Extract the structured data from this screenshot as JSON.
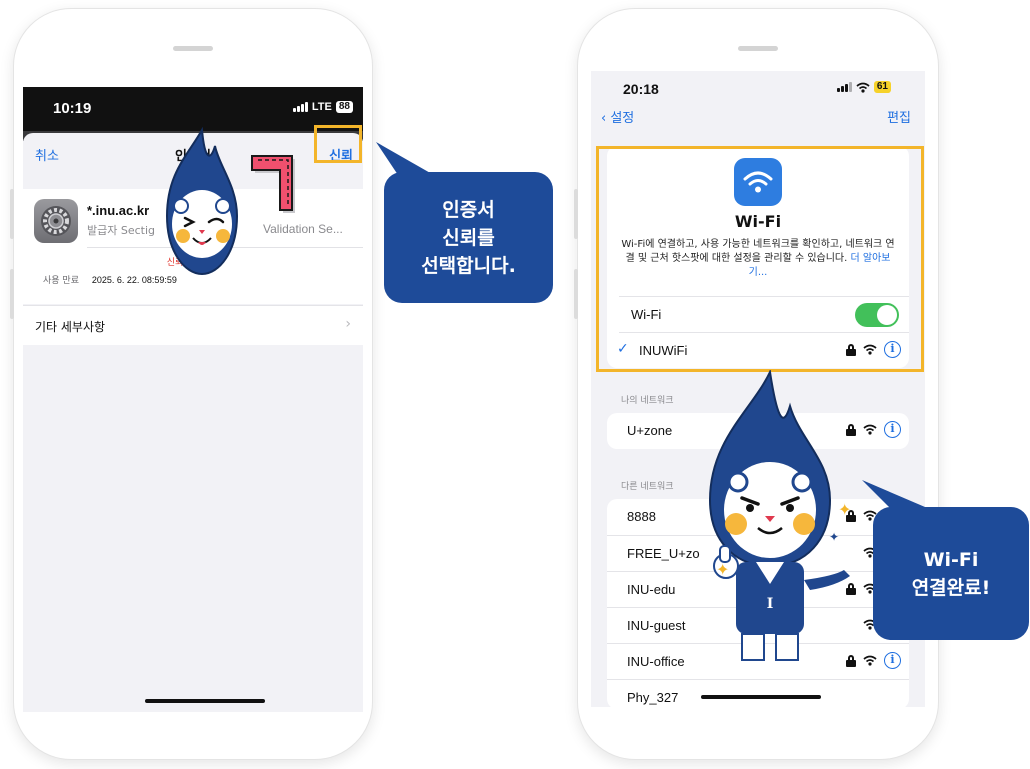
{
  "left_phone": {
    "status": {
      "time": "10:19",
      "network": "LTE",
      "battery": "88"
    },
    "nav": {
      "cancel": "취소",
      "title": "인증서",
      "trust": "신뢰"
    },
    "certificate": {
      "name": "*.inu.ac.kr",
      "issuer_visible": "발급자 Sectig",
      "issuer_tail": "Validation Se...",
      "trust_status": "신뢰하지 않음",
      "expiry_label": "사용 만료",
      "expiry_value": "2025. 6. 22. 08:59:59"
    },
    "details_row": "기타 세부사항",
    "icons": {
      "app": "settings-gear-icon",
      "chevron": "chevron-right-icon"
    }
  },
  "right_phone": {
    "status": {
      "time": "20:18",
      "battery": "61"
    },
    "nav": {
      "back": "설정",
      "edit": "편집"
    },
    "wifi_card": {
      "title": "Wi-Fi",
      "description": "Wi-Fi에 연결하고, 사용 가능한 네트워크를 확인하고, 네트워크 연결 및 근처 핫스팟에 대한 설정을 관리할 수 있습니다.",
      "learn_more": "더 알아보기...",
      "toggle_label": "Wi-Fi",
      "toggle_on": true,
      "connected_network": "INUWiFi"
    },
    "my_networks": {
      "label": "나의 네트워크",
      "items": [
        "U+zone"
      ]
    },
    "other_networks": {
      "label": "다른 네트워크",
      "items": [
        "8888",
        "FREE_U+zo",
        "INU-edu",
        "INU-guest",
        "INU-office",
        "Phy_327"
      ]
    }
  },
  "callouts": {
    "left": {
      "lines": [
        "인증서",
        "신뢰를",
        "선택합니다."
      ]
    },
    "right": {
      "lines": [
        "Wi-Fi",
        "연결완료!"
      ]
    }
  },
  "colors": {
    "accent_blue": "#1f6fe0",
    "callout_navy": "#1e4b99",
    "highlight_yellow": "#f3b52a",
    "toggle_green": "#42c05a",
    "alert_red": "#e0342c",
    "pink_arrow": "#f0506e"
  }
}
